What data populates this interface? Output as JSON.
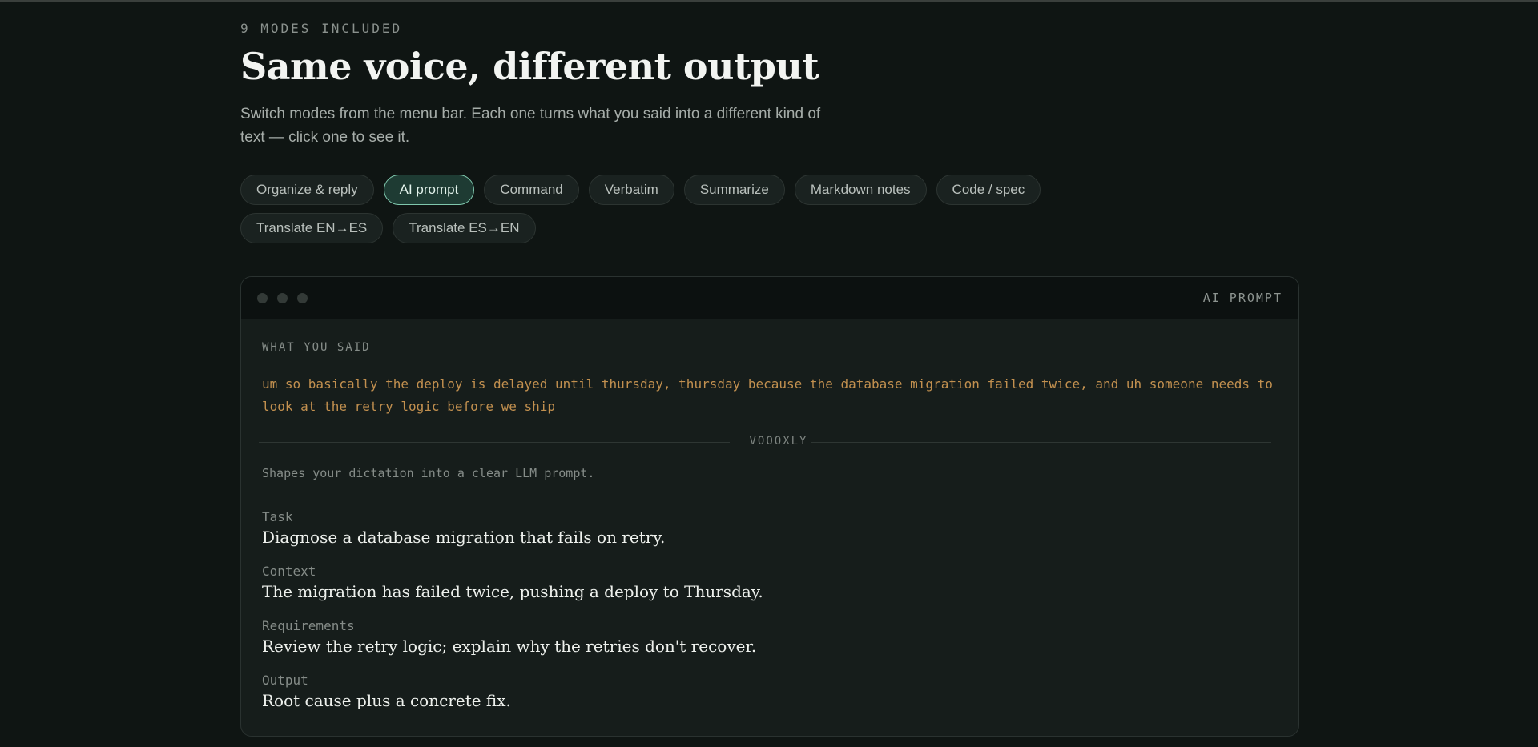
{
  "header": {
    "eyebrow": "9 MODES INCLUDED",
    "title": "Same voice, different output",
    "subtitle": "Switch modes from the menu bar. Each one turns what you said into a different kind of text — click one to see it."
  },
  "modes": [
    {
      "label": "Organize & reply",
      "active": false
    },
    {
      "label": "AI prompt",
      "active": true
    },
    {
      "label": "Command",
      "active": false
    },
    {
      "label": "Verbatim",
      "active": false
    },
    {
      "label": "Summarize",
      "active": false
    },
    {
      "label": "Markdown notes",
      "active": false
    },
    {
      "label": "Code / spec",
      "active": false
    },
    {
      "label": "Translate EN→ES",
      "active": false
    },
    {
      "label": "Translate ES→EN",
      "active": false
    }
  ],
  "panel": {
    "label": "AI PROMPT",
    "said_heading": "WHAT YOU SAID",
    "said_text": "um so basically the deploy is delayed until thursday, thursday because the database migration failed twice, and uh someone needs to look at the retry logic before we ship",
    "divider_label": "VOOOXLY",
    "mode_description": "Shapes your dictation into a clear LLM prompt.",
    "sections": [
      {
        "label": "Task",
        "body": "Diagnose a database migration that fails on retry."
      },
      {
        "label": "Context",
        "body": "The migration has failed twice, pushing a deploy to Thursday."
      },
      {
        "label": "Requirements",
        "body": "Review the retry logic; explain why the retries don't recover."
      },
      {
        "label": "Output",
        "body": "Root cause plus a concrete fix."
      }
    ]
  },
  "colors": {
    "background": "#0f1513",
    "accent": "#7fc7ad",
    "said_text": "#c2904f"
  }
}
